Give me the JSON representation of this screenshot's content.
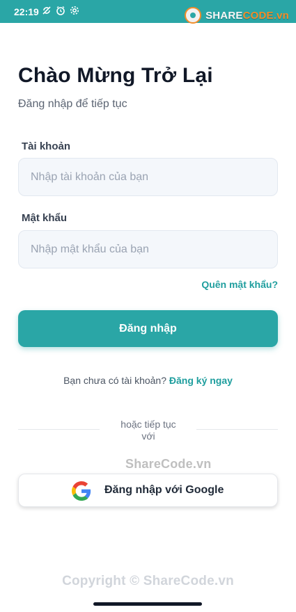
{
  "status_bar": {
    "time": "22:19",
    "icons": [
      "no-sync-icon",
      "alarm-icon",
      "gear-icon"
    ]
  },
  "watermark": {
    "brand_prefix": "SHARE",
    "brand_suffix": "CODE.vn",
    "mid_text": "ShareCode.vn",
    "copyright": "Copyright © ShareCode.vn"
  },
  "header": {
    "title": "Chào Mừng Trở Lại",
    "subtitle": "Đăng nhập để tiếp tục"
  },
  "form": {
    "account_label": "Tài khoản",
    "account_placeholder": "Nhập tài khoản của bạn",
    "password_label": "Mật khẩu",
    "password_placeholder": "Nhập mật khẩu của bạn",
    "forgot_link": "Quên mật khẩu?",
    "login_button": "Đăng nhập"
  },
  "signup": {
    "prompt": "Bạn chưa có tài khoản?",
    "link": "Đăng ký ngay"
  },
  "divider": {
    "line1": "hoặc tiếp tục",
    "line2": "với"
  },
  "google": {
    "label": "Đăng nhập với Google"
  },
  "colors": {
    "primary": "#2aa6a6",
    "link": "#1f9e9e",
    "input_bg": "#f4f7fb"
  }
}
